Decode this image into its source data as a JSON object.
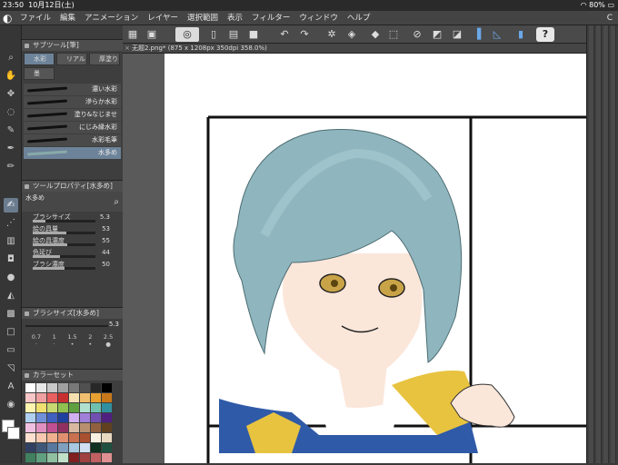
{
  "status": {
    "time": "23:50",
    "date": "10月12日(土)",
    "battery": "80%"
  },
  "menu": {
    "items": [
      "ファイル",
      "編集",
      "アニメーション",
      "レイヤー",
      "選択範囲",
      "表示",
      "フィルター",
      "ウィンドウ",
      "ヘルプ"
    ],
    "ctr": "C"
  },
  "subtool": {
    "title": "サブツール[筆]",
    "tabs": [
      "水彩",
      "リアル",
      "厚塗り",
      "墨"
    ],
    "brushes": [
      "濃い水彩",
      "滲らか水彩",
      "塗り&なじませ",
      "にじみ縁水彩",
      "水彩毛筆",
      "水多め"
    ]
  },
  "toolprop": {
    "title": "ツールプロパティ[水多め]",
    "name": "水多め",
    "props": [
      {
        "label": "ブラシサイズ",
        "value": "5.3",
        "level": 0.2
      },
      {
        "label": "絵の具量",
        "value": "53",
        "level": 0.53
      },
      {
        "label": "絵の具濃度",
        "value": "55",
        "level": 0.55
      },
      {
        "label": "色延び",
        "value": "44",
        "level": 0.44
      },
      {
        "label": "ブラシ濃度",
        "value": "50",
        "level": 0.5
      }
    ]
  },
  "brushsize": {
    "title": "ブラシサイズ[水多め]",
    "value": "5.3",
    "sizes": [
      "0.7",
      "1",
      "1.5",
      "2",
      "2.5"
    ]
  },
  "colorset": {
    "title": "カラーセット",
    "colors": [
      "#ffffff",
      "#e8e8e8",
      "#c8c8c8",
      "#a0a0a0",
      "#787878",
      "#505050",
      "#282828",
      "#000000",
      "#f7c6c6",
      "#f0a0a0",
      "#e86060",
      "#c83030",
      "#f7e0b0",
      "#f0c070",
      "#e8a030",
      "#c87818",
      "#fff5b0",
      "#f0e070",
      "#c8d870",
      "#90c050",
      "#60a040",
      "#b0e0d0",
      "#70c0b0",
      "#3090a0",
      "#b0d0f0",
      "#7090d8",
      "#4060c0",
      "#2040a0",
      "#d0b0f0",
      "#a080d8",
      "#7050b0",
      "#502080",
      "#f0c0e0",
      "#e090c0",
      "#c05090",
      "#903060",
      "#d8b8a0",
      "#b89070",
      "#906040",
      "#604020",
      "#ffe0d0",
      "#f8c8b0",
      "#f0b090",
      "#e09070",
      "#c87050",
      "#a85030",
      "#f8f0e0",
      "#e8d8c0",
      "#304060",
      "#405878",
      "#5878a0",
      "#80a0c0",
      "#a8c8e0",
      "#d0e0f0",
      "#103020",
      "#205040",
      "#408060",
      "#60a080",
      "#90c0a0",
      "#c0e0c8",
      "#802020",
      "#a04040",
      "#c06060",
      "#e09090"
    ]
  },
  "canvas": {
    "tab": "无题2.png* (875 x 1208px 350dpi 358.0%)"
  },
  "colors": {
    "accent": "#6d8399",
    "panel": "#3c3c3c",
    "toolbar": "#4a4a4a",
    "help": "#e8e8e8"
  }
}
